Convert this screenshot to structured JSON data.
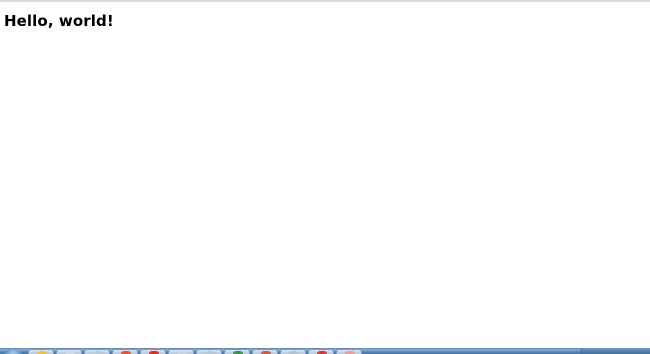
{
  "document": {
    "heading": "Hello, world!"
  },
  "taskbar": {
    "buttons": [
      {
        "icon": "explorer-icon",
        "color": "#e8c34a"
      },
      {
        "icon": "document-icon",
        "color": "#cfd9e6"
      },
      {
        "icon": "window-icon",
        "color": "#b9c9dc"
      },
      {
        "icon": "media-icon",
        "color": "#e05a3a"
      },
      {
        "icon": "browser-icon",
        "color": "#d8332b"
      },
      {
        "icon": "folder-icon",
        "color": "#c8d4e2"
      },
      {
        "icon": "app-icon",
        "color": "#b7c7d9"
      },
      {
        "icon": "network-icon",
        "color": "#3f8f4f"
      },
      {
        "icon": "tool-icon",
        "color": "#c9604a"
      },
      {
        "icon": "window2-icon",
        "color": "#b5c3d4"
      },
      {
        "icon": "paint-icon",
        "color": "#c8403a"
      },
      {
        "icon": "app2-icon",
        "color": "#e3a0a0"
      }
    ]
  }
}
